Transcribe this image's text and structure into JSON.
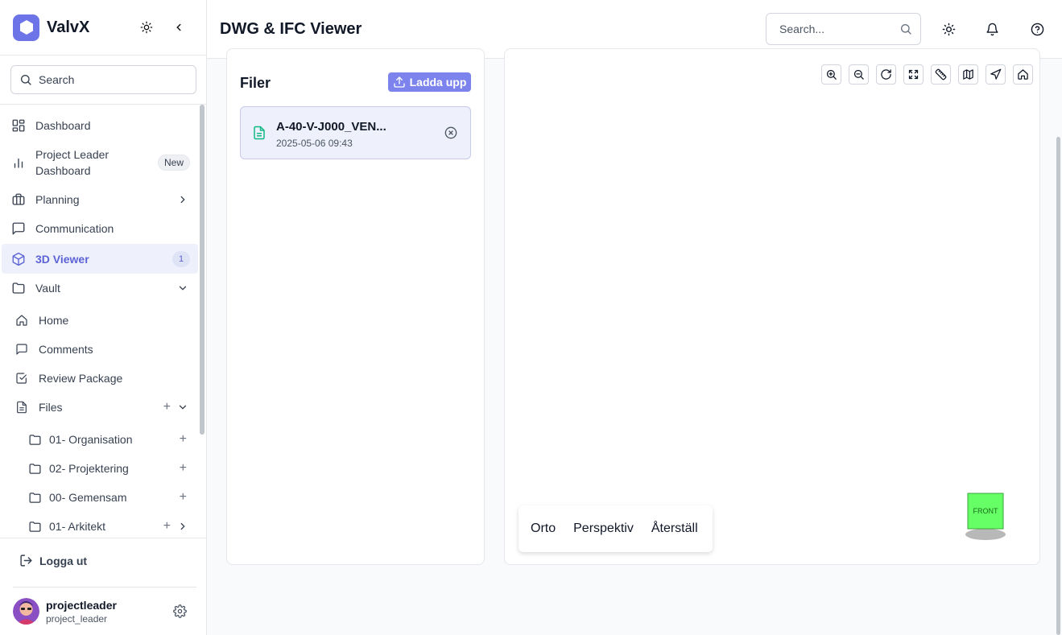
{
  "app": {
    "name": "ValvX"
  },
  "sidebar": {
    "search_placeholder": "Search",
    "items": [
      {
        "label": "Dashboard"
      },
      {
        "label": "Project Leader Dashboard",
        "badge": "New"
      },
      {
        "label": "Planning"
      },
      {
        "label": "Communication"
      },
      {
        "label": "3D Viewer",
        "badge": "1"
      },
      {
        "label": "Vault"
      },
      {
        "label": "Home"
      },
      {
        "label": "Comments"
      },
      {
        "label": "Review Package"
      },
      {
        "label": "Files"
      },
      {
        "label": "01- Organisation"
      },
      {
        "label": "02- Projektering"
      },
      {
        "label": "00- Gemensam"
      },
      {
        "label": "01- Arkitekt"
      }
    ],
    "project_leader_line1": "Project Leader",
    "project_leader_line2": "Dashboard",
    "logout_label": "Logga ut",
    "user": {
      "name": "projectleader",
      "handle": "project_leader"
    }
  },
  "header": {
    "title": "DWG & IFC Viewer",
    "search_placeholder": "Search..."
  },
  "files_panel": {
    "title": "Filer",
    "upload_label": "Ladda upp",
    "files": [
      {
        "name": "A-40-V-J000_VEN...",
        "date": "2025-05-06 09:43"
      }
    ]
  },
  "viewer": {
    "toolbar_icons": [
      "zoom-in-icon",
      "zoom-out-icon",
      "rotate-icon",
      "fullscreen-icon",
      "measure-icon",
      "map-icon",
      "navigate-icon",
      "home-icon"
    ],
    "view_modes": {
      "ortho": "Orto",
      "perspective": "Perspektiv",
      "reset": "Återställ"
    },
    "nav_cube_label": "FRONT"
  },
  "colors": {
    "accent": "#5c63d6",
    "upload_button": "#7c83ec",
    "nav_cube": "#66ff66"
  }
}
